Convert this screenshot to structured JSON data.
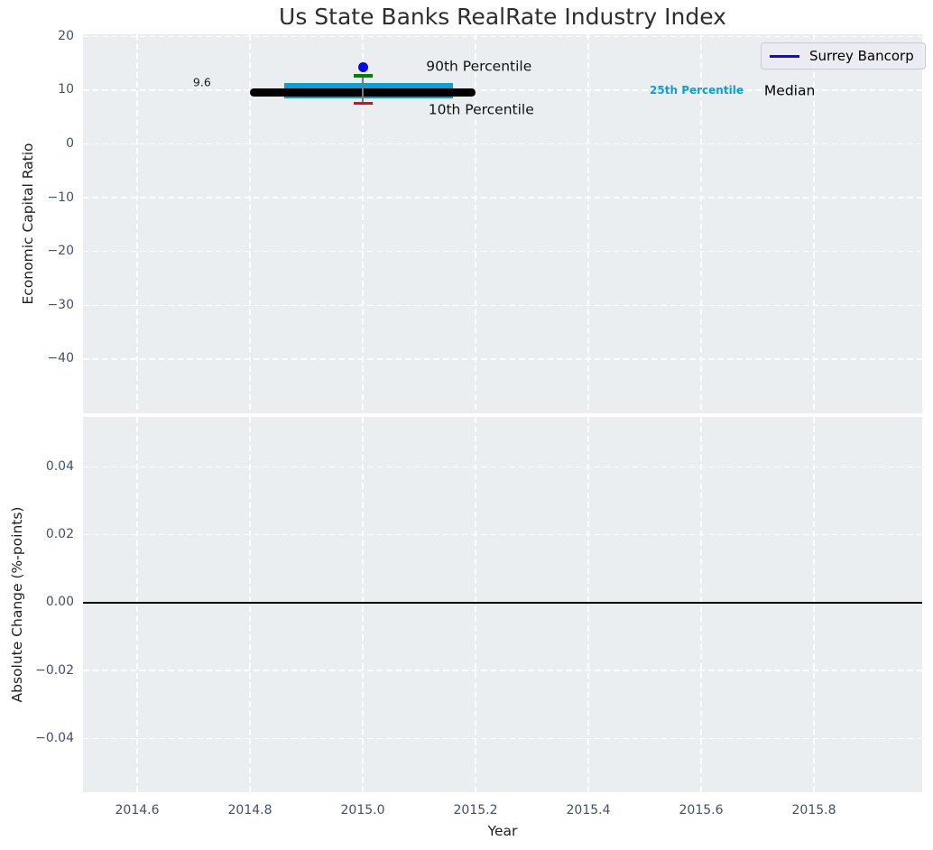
{
  "title": "Us State Banks RealRate Industry Index",
  "axis_labels": {
    "top_y": "Economic Capital Ratio",
    "bottom_y": "Absolute Change (%-points)",
    "x": "Year"
  },
  "legend": {
    "entries": [
      {
        "label": "Surrey Bancorp",
        "color": "#0a0aee"
      }
    ]
  },
  "colors": {
    "figure_bg": "#ffffff",
    "plot_bg": "#eaeef1",
    "grid": "#ffffff",
    "tick_label": "#44506b",
    "axis_label": "#1f1f1f",
    "title": "#2e2e2e"
  },
  "chart_data": [
    {
      "type": "line",
      "panel": "economic-capital-ratio",
      "title": "Us State Banks RealRate Industry Index",
      "xlabel": "",
      "ylabel": "Economic Capital Ratio",
      "xlim": [
        2014.504,
        2015.992
      ],
      "ylim": [
        -50.1,
        20.4
      ],
      "grid": {
        "show": true,
        "style": "dashed",
        "color": "#ffffff"
      },
      "legend_position": "upper right",
      "xticks": {
        "values": [
          2014.6,
          2014.8,
          2015.0,
          2015.2,
          2015.4,
          2015.6,
          2015.8
        ],
        "labels": [
          "2014.6",
          "2014.8",
          "2015.0",
          "2015.2",
          "2015.4",
          "2015.6",
          "2015.8"
        ]
      },
      "yticks": {
        "values": [
          20,
          10,
          0,
          -10,
          -20,
          -30,
          -40
        ],
        "labels": [
          "20",
          "10",
          "0",
          "−10",
          "−20",
          "−30",
          "−40"
        ]
      },
      "series": [
        {
          "name": "25th-75th Percentile Range",
          "kind": "band",
          "x": [
            2014.86,
            2015.16
          ],
          "y": [
            8.4,
            11.4
          ],
          "color": "#0aa0d6"
        },
        {
          "name": "Median",
          "kind": "hline-segment",
          "x": [
            2014.8,
            2015.2
          ],
          "y": 9.6,
          "color": "#000000",
          "linewidth": 8.5
        },
        {
          "name": "10th-90th Percentile Whisker",
          "kind": "errorbar",
          "x": 2015.0,
          "y": [
            7.6,
            12.7
          ],
          "line_color": "#7a7a7a",
          "cap_top_color": "#018001",
          "cap_bottom_color": "#fb0100"
        },
        {
          "name": "Surrey Bancorp",
          "kind": "point",
          "x": 2015.0,
          "y": 14.3,
          "color": "#0505f0",
          "size": 11
        }
      ],
      "annotations": [
        {
          "text": "9.6",
          "x": 2014.715,
          "y": 11.5,
          "color": "#1a1a1a",
          "size": 12.5,
          "bold": false
        },
        {
          "text": "90th Percentile",
          "x": 2015.206,
          "y": 14.36,
          "color": "#111111",
          "size": 15.5,
          "bold": false
        },
        {
          "text": "10th Percentile",
          "x": 2015.21,
          "y": 6.3,
          "color": "#111111",
          "size": 15.5,
          "bold": false
        },
        {
          "text": "25th Percentile",
          "x": 2015.592,
          "y": 10.0,
          "color": "#0aa0d6",
          "size": 12,
          "bold": true
        },
        {
          "text": "Median",
          "x": 2015.757,
          "y": 9.82,
          "color": "#000000",
          "size": 15.5,
          "bold": false
        }
      ]
    },
    {
      "type": "line",
      "panel": "absolute-change",
      "xlabel": "Year",
      "ylabel": "Absolute Change (%-points)",
      "xlim": [
        2014.504,
        2015.992
      ],
      "ylim": [
        -0.0558,
        0.0547
      ],
      "grid": {
        "show": true,
        "style": "dashed",
        "color": "#ffffff"
      },
      "xticks": {
        "values": [
          2014.6,
          2014.8,
          2015.0,
          2015.2,
          2015.4,
          2015.6,
          2015.8
        ],
        "labels": [
          "2014.6",
          "2014.8",
          "2015.0",
          "2015.2",
          "2015.4",
          "2015.6",
          "2015.8"
        ]
      },
      "yticks": {
        "values": [
          0.04,
          0.02,
          0,
          -0.02,
          -0.04
        ],
        "labels": [
          "0.04",
          "0.02",
          "0.00",
          "−0.02",
          "−0.04"
        ]
      },
      "series": [
        {
          "name": "Zero Line",
          "kind": "hline",
          "y": 0.0,
          "color": "#000000",
          "linewidth": 2
        }
      ],
      "annotations": []
    }
  ]
}
